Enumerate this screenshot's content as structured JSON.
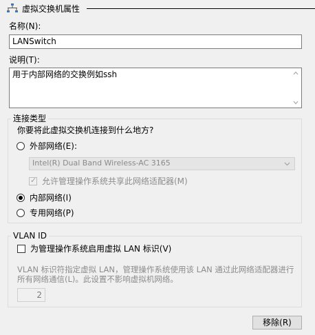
{
  "header": {
    "title": "虚拟交换机属性",
    "icon": "network-switch-icon"
  },
  "name_field": {
    "label": "名称(N):",
    "value": "LANSwitch"
  },
  "description_field": {
    "label": "说明(T):",
    "value": "用于内部网络的交换例如ssh"
  },
  "connection_type": {
    "title": "连接类型",
    "question": "你要将此虚拟交换机连接到什么地方?",
    "external": {
      "label": "外部网络(E):",
      "checked": false
    },
    "adapter_dropdown": {
      "value": "Intel(R) Dual Band Wireless-AC 3165"
    },
    "allow_mgmt": {
      "label": "允许管理操作系统共享此网络适配器(M)",
      "checked": true
    },
    "internal": {
      "label": "内部网络(I)",
      "checked": true
    },
    "private": {
      "label": "专用网络(P)",
      "checked": false
    }
  },
  "vlan": {
    "title": "VLAN ID",
    "enable": {
      "label": "为管理操作系统启用虚拟 LAN 标识(V)",
      "checked": false
    },
    "description_line1": "VLAN 标识符指定虚拟 LAN，管理操作系统使用该 LAN 通过此网络适配器进行",
    "description_line2": "所有网络通信(L)。此设置不影响虚拟机网络。",
    "id_value": "2"
  },
  "buttons": {
    "remove": "移除(R)"
  }
}
